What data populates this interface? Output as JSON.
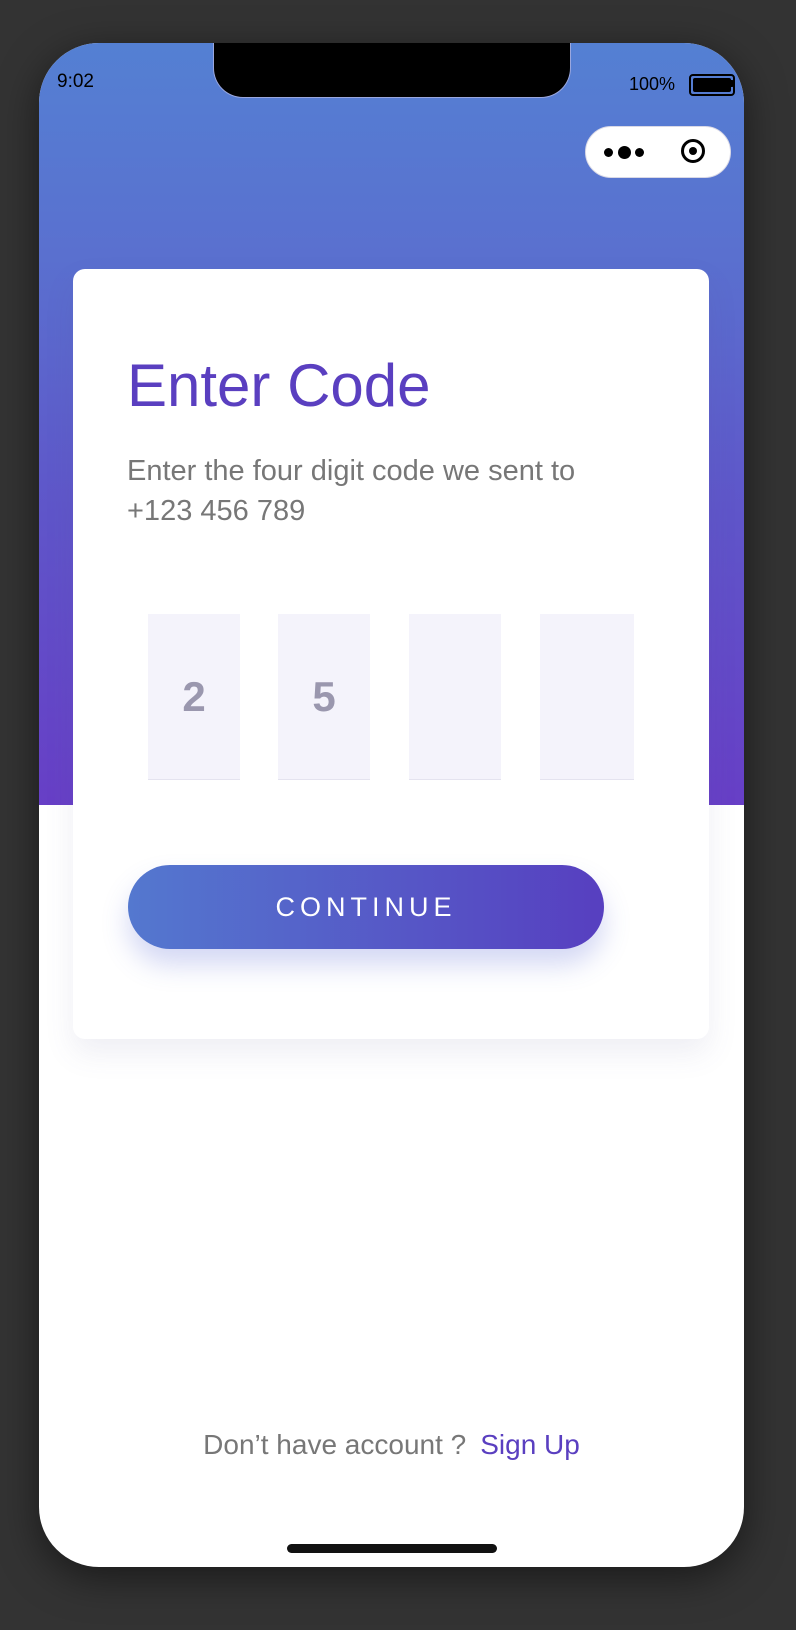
{
  "status_bar": {
    "time": "9:02",
    "battery_percent": "100%",
    "battery_level": 1.0
  },
  "capsule": {
    "menu_icon": "more-dots-icon",
    "close_icon": "target-circle-icon"
  },
  "card": {
    "title": "Enter Code",
    "description": "Enter the four digit code we sent to +123 456 789",
    "code_digits": [
      "2",
      "5",
      "",
      ""
    ],
    "continue_label": "CONTINUE"
  },
  "footer": {
    "prompt": "Don’t have account ?",
    "signup_label": "Sign Up"
  },
  "colors": {
    "accent": "#5a3fc0",
    "gradient_top": "#5480d3",
    "gradient_bottom": "#673fc6",
    "muted_text": "#777777",
    "code_box_bg": "#f4f3fb",
    "background": "#333333"
  }
}
